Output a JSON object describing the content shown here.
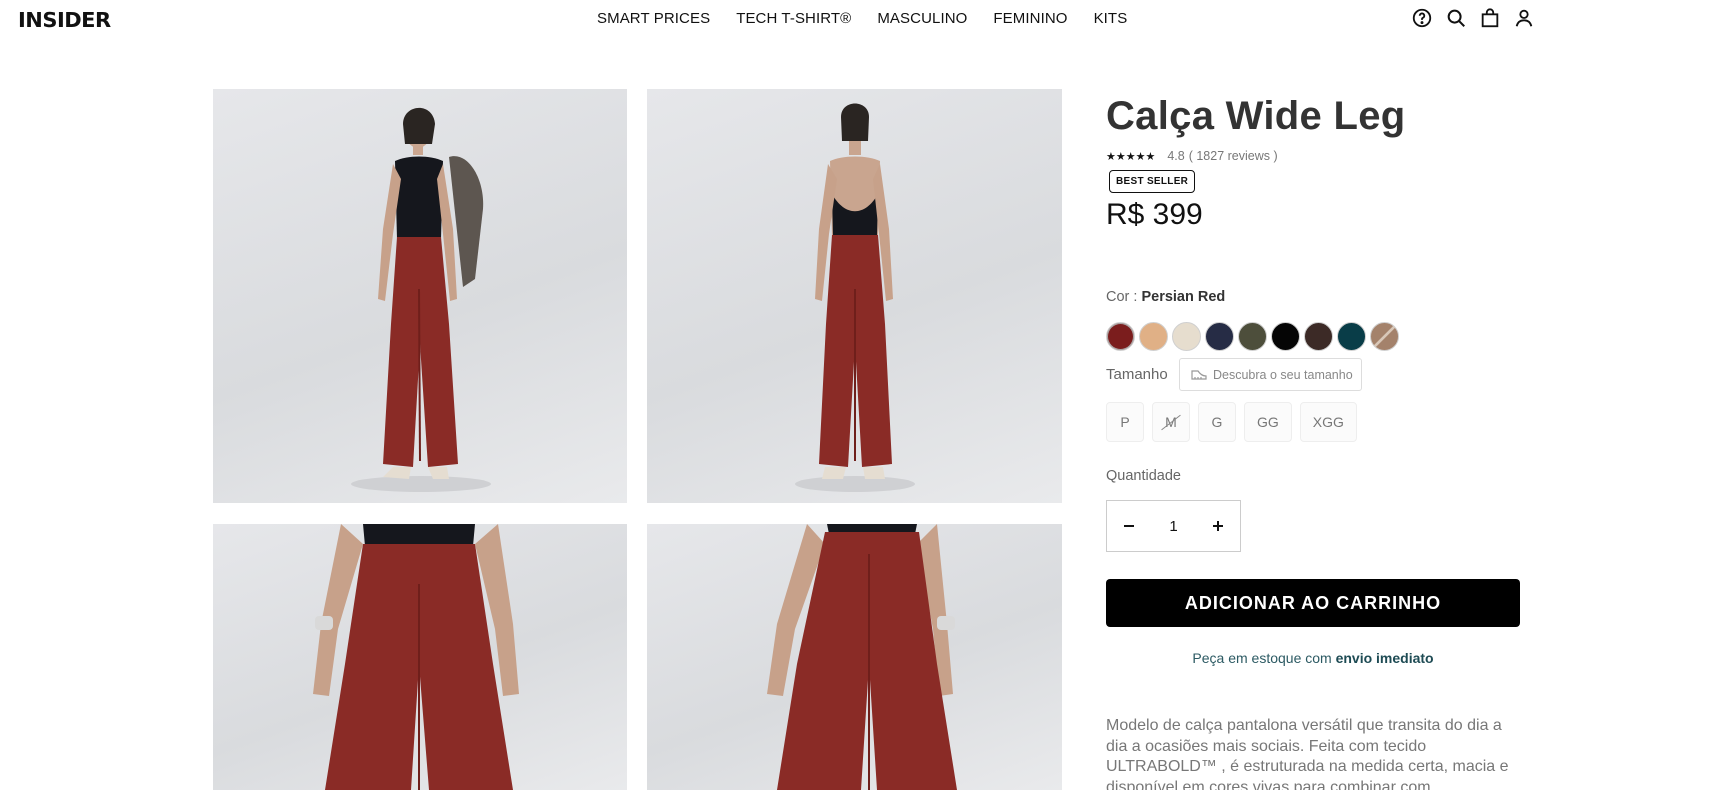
{
  "header": {
    "logo": "INSIDER",
    "nav": [
      "SMART PRICES",
      "TECH T-SHIRT®",
      "MASCULINO",
      "FEMININO",
      "KITS"
    ],
    "icons": [
      "help-icon",
      "search-icon",
      "bag-icon",
      "user-icon"
    ]
  },
  "product": {
    "title": "Calça Wide Leg",
    "stars": "★★★★★",
    "rating": "4.8",
    "reviews": "( 1827 reviews )",
    "badge": "BEST SELLER",
    "price": "R$ 399",
    "color_label": "Cor :",
    "color_value": "Persian Red",
    "colors": [
      "#7b1d1d",
      "#e0b086",
      "#e6ddce",
      "#262c45",
      "#4d4e3b",
      "#050505",
      "#3c2a26",
      "#093d48",
      "#a4826b"
    ],
    "size_label": "Tamanho",
    "size_guide": "Descubra o seu tamanho",
    "sizes": [
      {
        "label": "P",
        "available": true
      },
      {
        "label": "M",
        "available": false
      },
      {
        "label": "G",
        "available": true
      },
      {
        "label": "GG",
        "available": true
      },
      {
        "label": "XGG",
        "available": true
      }
    ],
    "quantity_label": "Quantidade",
    "quantity": "1",
    "add_to_cart": "ADICIONAR AO CARRINHO",
    "stock_text": "Peça em estoque com",
    "stock_bold": "envio imediato",
    "description": "Modelo de calça pantalona versátil que transita do dia a dia a ocasiões mais sociais. Feita com tecido ULTRABOLD™ , é estruturada na medida certa, macia e disponível em cores vivas para combinar com"
  }
}
